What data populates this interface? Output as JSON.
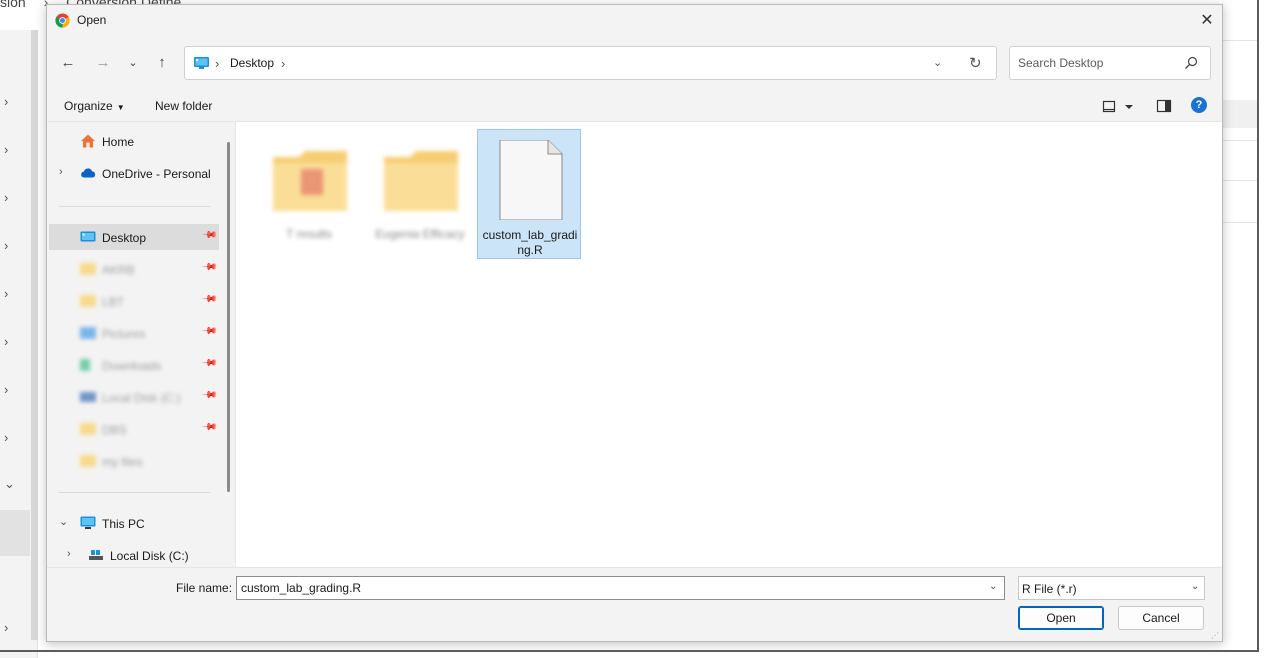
{
  "background": {
    "breadcrumb": [
      "sion",
      "Conversion Define"
    ]
  },
  "dialog": {
    "title": "Open",
    "close_label": "✕"
  },
  "address": {
    "crumb": "Desktop",
    "separator": "›"
  },
  "search": {
    "placeholder": "Search Desktop"
  },
  "commands": {
    "organize": "Organize",
    "new_folder": "New folder"
  },
  "nav": {
    "home": "Home",
    "onedrive": "OneDrive - Personal",
    "desktop": "Desktop",
    "blurred_items": [
      "AKRB",
      "LBT",
      "Pictures",
      "Downloads",
      "Local Disk (C:)",
      "DBS",
      "my files"
    ],
    "this_pc": "This PC",
    "local_disk": "Local Disk (C:)"
  },
  "files": [
    {
      "name": "T results",
      "type": "folder",
      "blurred": true
    },
    {
      "name": "Eugenia Efficacy",
      "type": "folder",
      "blurred": true
    },
    {
      "name": "custom_lab_grading.R",
      "type": "file",
      "selected": true
    }
  ],
  "bottom": {
    "filename_label": "File name:",
    "filename_value": "custom_lab_grading.R",
    "filetype": "R File (*.r)",
    "open": "Open",
    "cancel": "Cancel"
  },
  "colors": {
    "accent": "#0067c0",
    "selection": "#cce4f7",
    "folder": "#f9cf5e"
  }
}
